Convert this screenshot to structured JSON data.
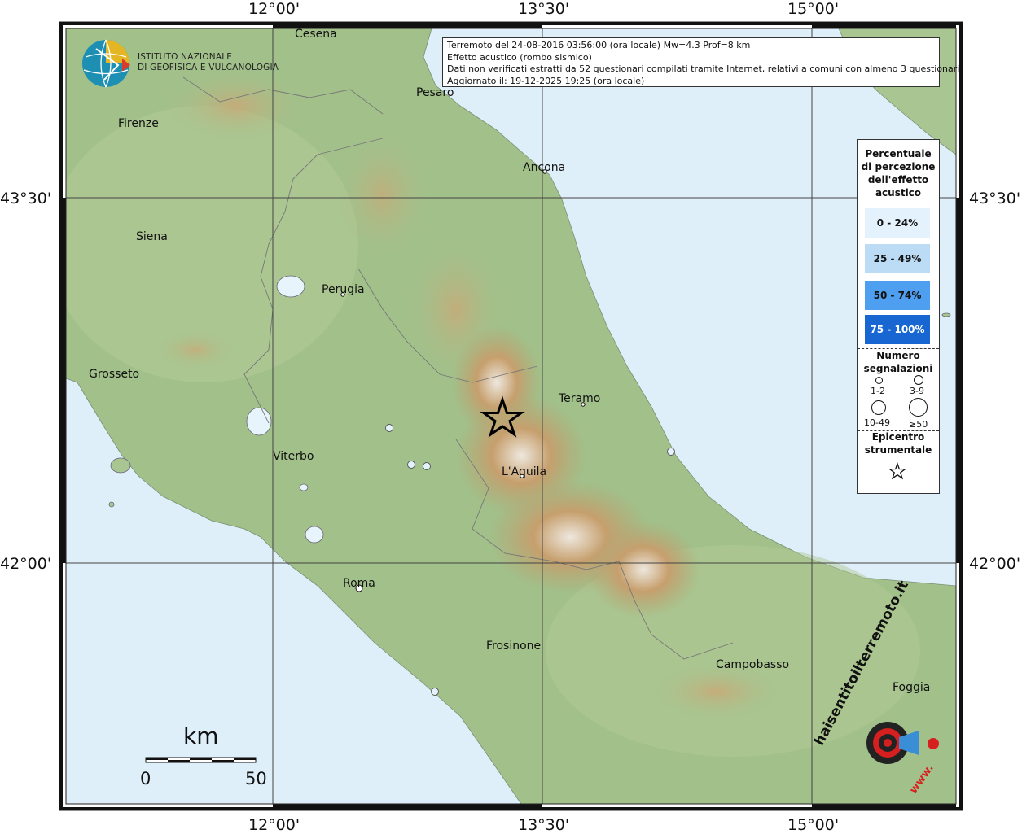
{
  "info": {
    "line1": "Terremoto del 24-08-2016 03:56:00 (ora locale) Mw=4.3 Prof=8 km",
    "line2": "Effetto acustico (rombo sismico)",
    "line3": "Dati non verificati estratti da 52 questionari compilati tramite Internet, relativi a comuni con almeno 3 questionari.",
    "line4": "Aggiornato il: 19-12-2025 19:25 (ora locale)"
  },
  "logo": {
    "line1": "ISTITUTO NAZIONALE",
    "line2": "DI GEOFISICA E VULCANOLOGIA"
  },
  "axes": {
    "lon": [
      "12°00'",
      "13°30'",
      "15°00'"
    ],
    "lat": [
      "43°30'",
      "42°00'"
    ]
  },
  "cities": {
    "cesena": "Cesena",
    "pesaro": "Pesaro",
    "firenze": "Firenze",
    "ancona": "Ancona",
    "siena": "Siena",
    "perugia": "Perugia",
    "grosseto": "Grosseto",
    "teramo": "Teramo",
    "viterbo": "Viterbo",
    "laquila": "L'Aquila",
    "roma": "Roma",
    "frosinone": "Frosinone",
    "campobasso": "Campobasso",
    "foggia": "Foggia"
  },
  "legend": {
    "title": [
      "Percentuale",
      "di percezione",
      "dell'effetto",
      "acustico"
    ],
    "ranges": [
      {
        "label": "0 - 24%",
        "color": "#e3f2fc"
      },
      {
        "label": "25 - 49%",
        "color": "#bcdcf6"
      },
      {
        "label": "50 - 74%",
        "color": "#4f9ff0"
      },
      {
        "label": "75 - 100%",
        "color": "#1766d2"
      }
    ],
    "count_title": [
      "Numero",
      "segnalazioni"
    ],
    "counts": [
      "1-2",
      "3-9",
      "10-49",
      "≥50"
    ],
    "epicenter_title": [
      "Epicentro",
      "strumentale"
    ]
  },
  "scale": {
    "unit": "km",
    "start": "0",
    "end": "50"
  },
  "watermark": {
    "text1": "haisentitoilterremoto.it",
    "text2": "www."
  },
  "colors": {
    "sea": "#dfeffa",
    "land": "#a2c08a",
    "mountain": "#c19a68",
    "peak": "#f3efe8",
    "grid": "#444444",
    "epicenter": "#000000"
  },
  "observations": [
    {
      "place": "point near Terni",
      "percent_range": "0 - 24%",
      "count_range": "1-2"
    },
    {
      "place": "point near Rieti 1",
      "percent_range": "0 - 24%",
      "count_range": "1-2"
    },
    {
      "place": "point near Rieti 2",
      "percent_range": "0 - 24%",
      "count_range": "1-2"
    },
    {
      "place": "point coast Abruzzo",
      "percent_range": "0 - 24%",
      "count_range": "1-2"
    },
    {
      "place": "point south Lazio",
      "percent_range": "0 - 24%",
      "count_range": "1-2"
    }
  ]
}
